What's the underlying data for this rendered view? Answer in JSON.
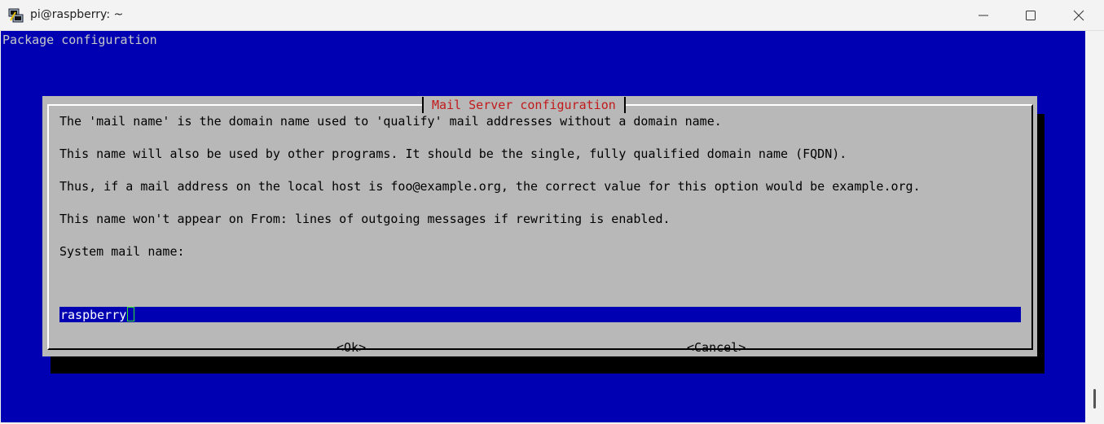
{
  "window": {
    "title": "pi@raspberry: ~",
    "icons": {
      "app": "putty-icon",
      "minimize": "minimize-icon",
      "maximize": "maximize-icon",
      "close": "close-icon"
    }
  },
  "terminal": {
    "header": "Package configuration",
    "background_color": "#0000b2"
  },
  "dialog": {
    "title": "Mail Server configuration",
    "paragraphs": [
      "The 'mail name' is the domain name used to 'qualify' mail addresses without a domain name.",
      "This name will also be used by other programs. It should be the single, fully qualified domain name (FQDN).",
      "Thus, if a mail address on the local host is foo@example.org, the correct value for this option would be example.org.",
      "This name won't appear on From: lines of outgoing messages if rewriting is enabled."
    ],
    "prompt_label": "System mail name:",
    "input_value": "raspberry",
    "ok_label": "<Ok>",
    "cancel_label": "<Cancel>",
    "title_color": "#c21a1a",
    "background_color": "#b8b8b8"
  }
}
